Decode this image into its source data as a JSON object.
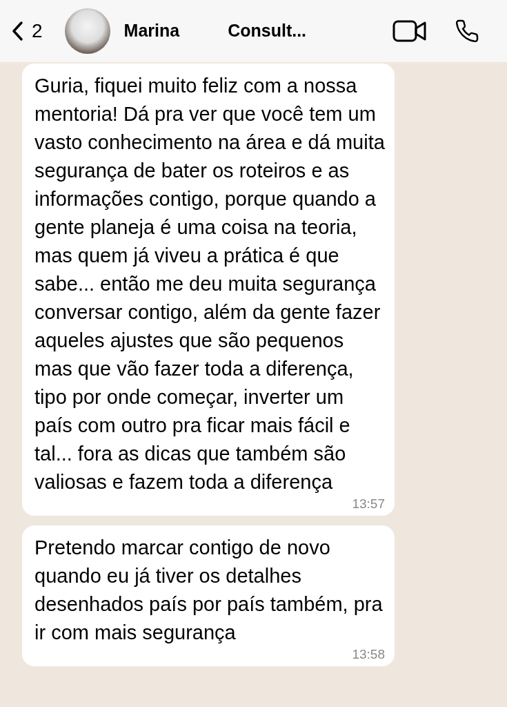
{
  "header": {
    "back_count": "2",
    "name": "Marina",
    "name_rest": "Consult..."
  },
  "messages": [
    {
      "text": "Guria, fiquei muito feliz com a nossa mentoria! Dá pra ver que você tem um vasto conhecimento na área e dá muita segurança de bater os roteiros e as informações contigo, porque quando a gente planeja é uma coisa na teoria, mas quem já viveu a prática é que sabe... então me deu muita segurança conversar contigo, além da gente fazer aqueles ajustes que são pequenos mas que vão fazer toda a diferença, tipo por onde começar, inverter um país com outro pra ficar mais fácil e tal... fora as dicas que também são valiosas e fazem toda a diferença",
      "time": "13:57"
    },
    {
      "text": "Pretendo marcar contigo de novo quando eu já tiver os detalhes desenhados país por país também, pra ir com mais segurança",
      "time": "13:58"
    }
  ]
}
